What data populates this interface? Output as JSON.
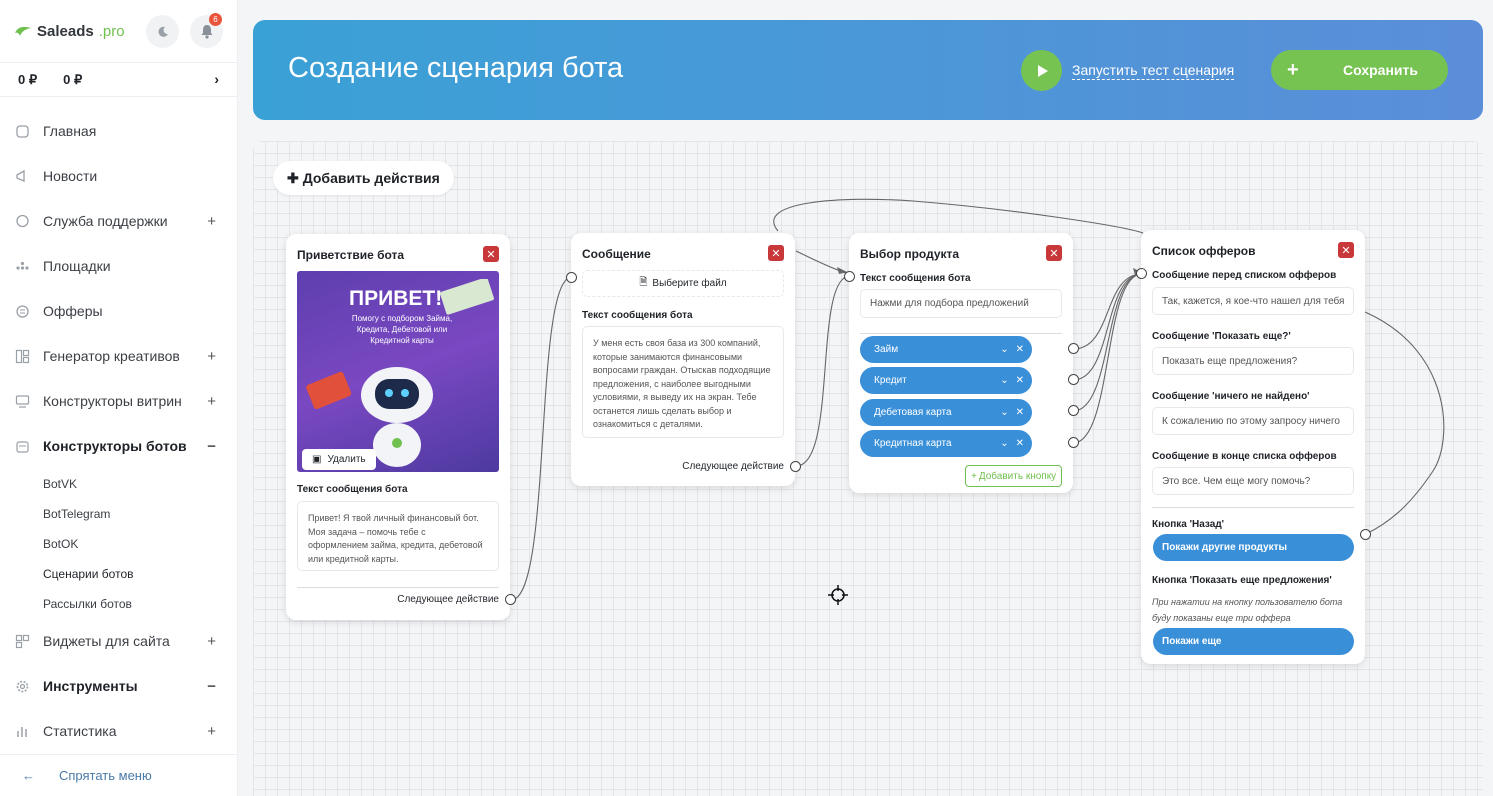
{
  "sidebar": {
    "brand": "Saleads",
    "brand_suffix": ".pro",
    "notifications_count": "6",
    "balances": [
      "0 ₽",
      "0 ₽"
    ],
    "nav": [
      {
        "label": "Главная",
        "icon": "home-icon",
        "plus": ""
      },
      {
        "label": "Новости",
        "icon": "megaphone-icon",
        "plus": ""
      },
      {
        "label": "Служба поддержки",
        "icon": "chat-icon",
        "plus": "+"
      },
      {
        "label": "Площадки",
        "icon": "dots-icon",
        "plus": ""
      },
      {
        "label": "Офферы",
        "icon": "offer-icon",
        "plus": ""
      },
      {
        "label": "Генератор креативов",
        "icon": "creative-icon",
        "plus": "+"
      },
      {
        "label": "Конструкторы витрин",
        "icon": "showcase-icon",
        "plus": "+"
      },
      {
        "label": "Конструкторы ботов",
        "icon": "bot-icon",
        "plus": "−"
      },
      {
        "label": "Виджеты для сайта",
        "icon": "widget-icon",
        "plus": "+"
      },
      {
        "label": "Инструменты",
        "icon": "gear-icon",
        "plus": "−"
      },
      {
        "label": "Статистика",
        "icon": "stats-icon",
        "plus": "+"
      }
    ],
    "sub_items": [
      "BotVK",
      "BotTelegram",
      "BotOK",
      "Сценарии ботов",
      "Рассылки ботов"
    ],
    "hide_menu": "Спрятать меню"
  },
  "header": {
    "title": "Создание сценария бота",
    "test_label": "Запустить тест сценария",
    "save_label": "Сохранить"
  },
  "canvas": {
    "add_action": "Добавить действия",
    "greeting": {
      "title": "Приветствие бота",
      "promo_title": "ПРИВЕТ!",
      "promo_sub": "Помогу с подбором Займа, Кредита, Дебетовой или Кредитной карты",
      "delete_label": "Удалить",
      "text_label": "Текст сообщения бота",
      "text": "Привет! Я твой личный финансовый бот. Моя задача – помочь тебе с оформлением займа, кредита, дебетовой или кредитной карты.",
      "next_label": "Следующее действие"
    },
    "message": {
      "title": "Сообщение",
      "file_label": "Выберите файл",
      "text_label": "Текст сообщения бота",
      "text": "У меня есть своя база из 300 компаний, которые занимаются финансовыми вопросами граждан. Отыскав подходящие предложения, с наиболее выгодными условиями, я выведу их на экран. Тебе останется лишь сделать выбор и ознакомиться с деталями.",
      "next_label": "Следующее действие"
    },
    "product": {
      "title": "Выбор продукта",
      "text_label": "Текст сообщения бота",
      "input_value": "Нажми для подбора предложений",
      "options": [
        "Займ",
        "Кредит",
        "Дебетовая карта",
        "Кредитная карта"
      ],
      "add_button": "Добавить кнопку"
    },
    "offers": {
      "title": "Список офферов",
      "before_label": "Сообщение перед списком офферов",
      "before_value": "Так, кажется, я кое-что нашел для тебя",
      "more_label": "Сообщение 'Показать еще?'",
      "more_value": "Показать еще предложения?",
      "none_label": "Сообщение 'ничего не найдено'",
      "none_value": "К сожалению по этому запросу ничего",
      "end_label": "Сообщение в конце списка офферов",
      "end_value": "Это все. Чем еще могу помочь?",
      "back_label": "Кнопка 'Назад'",
      "back_button": "Покажи другие продукты",
      "show_more_label": "Кнопка 'Показать еще предложения'",
      "show_more_note": "При нажатии на кнопку пользователю бота буду показаны еще три оффера",
      "show_more_button": "Покажи еще"
    }
  }
}
